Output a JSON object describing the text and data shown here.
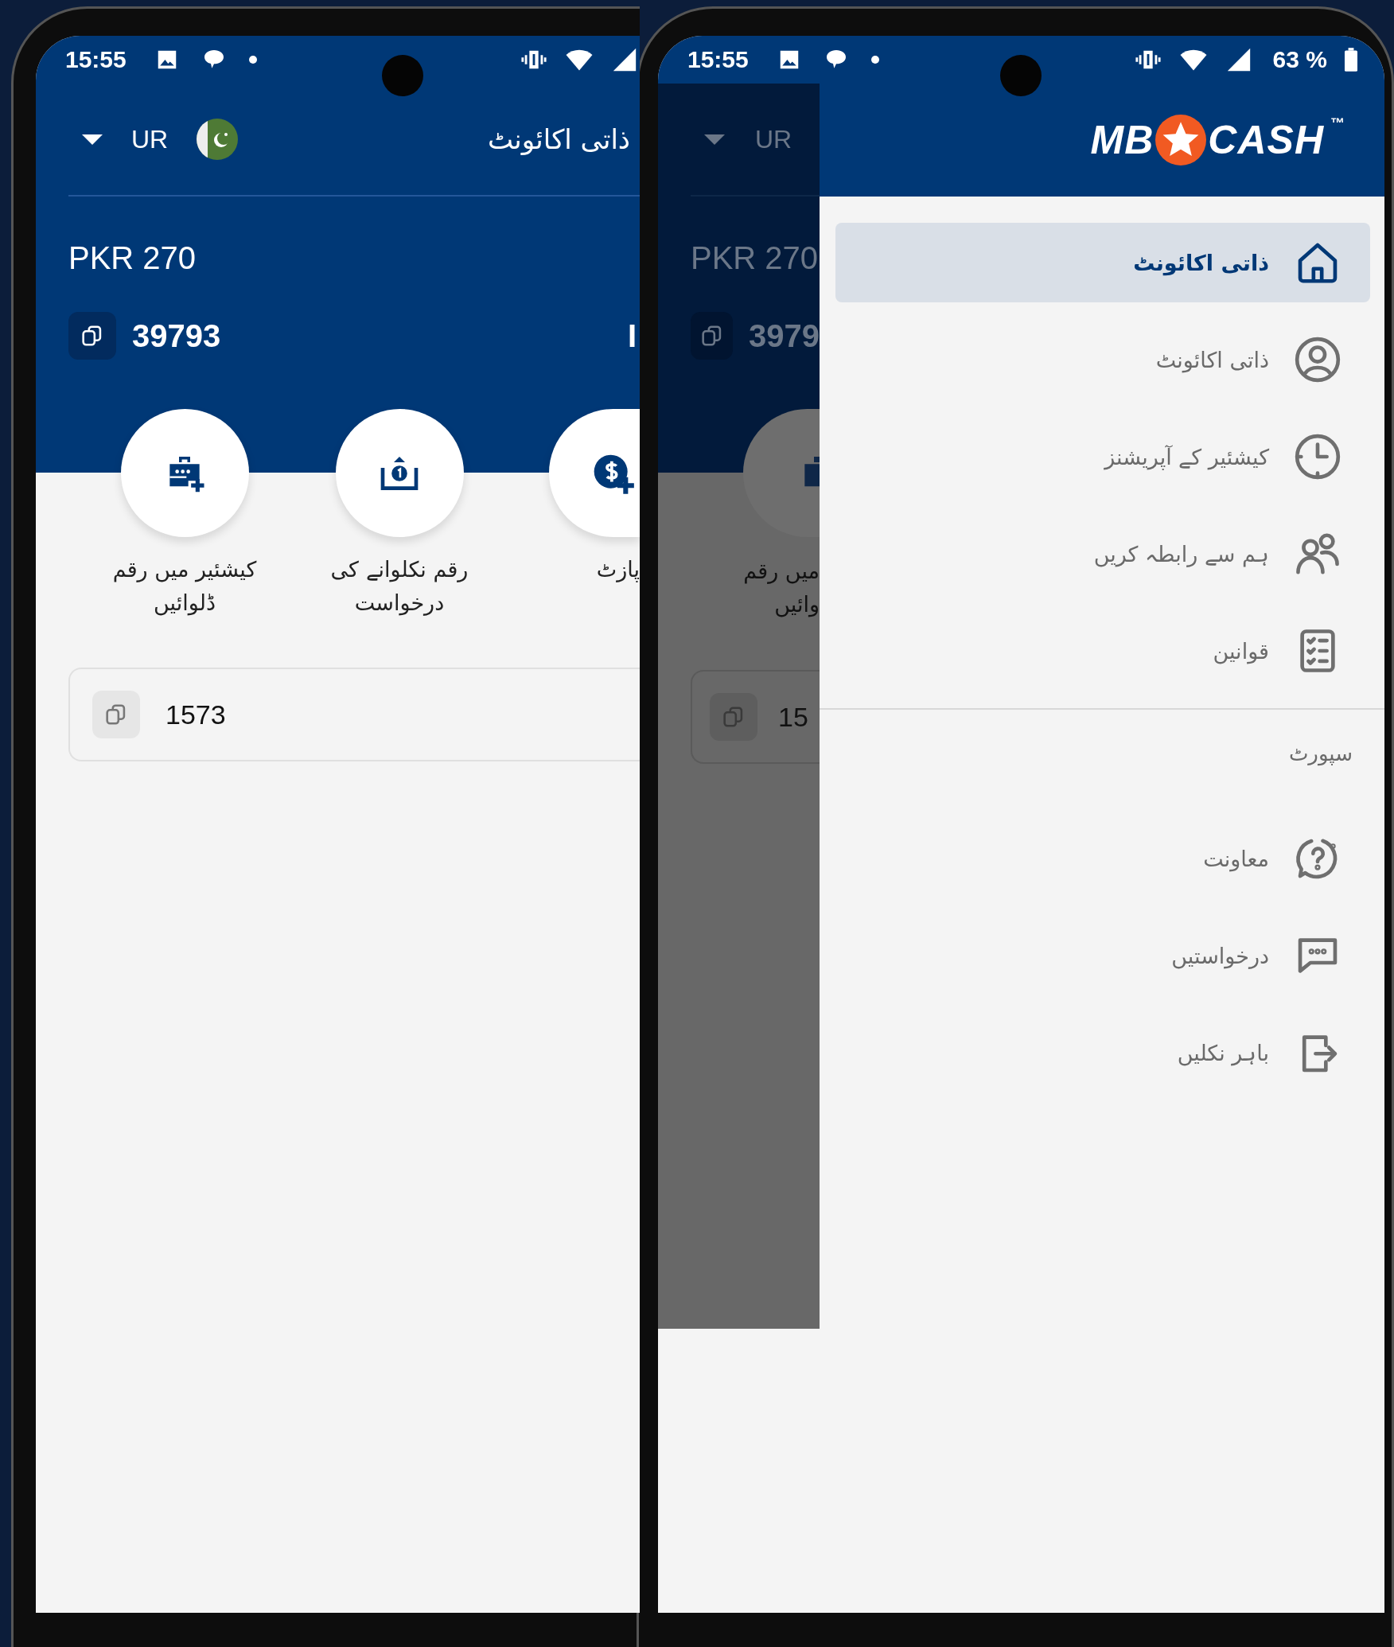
{
  "left_screen": {
    "status_bar": {
      "time": "15:55"
    },
    "header": {
      "language": "UR",
      "title": "ذاتی اکائونٹ"
    },
    "balance": "PKR 270",
    "account": {
      "number": "39793",
      "label": "I"
    },
    "actions": [
      {
        "kind": "deposit",
        "lines": [
          "پازٹ"
        ]
      },
      {
        "kind": "withdraw",
        "lines": [
          "رقم نکلوانے کی",
          "درخواست"
        ]
      },
      {
        "kind": "cashier",
        "lines": [
          "کیشئیر میں رقم",
          "ڈلوائیں"
        ]
      }
    ],
    "code_field": {
      "value": "1573"
    }
  },
  "right_screen": {
    "status_bar": {
      "time": "15:55",
      "battery": "63 %"
    },
    "dimmed_app": {
      "language": "UR",
      "balance": "PKR 270",
      "account_number": "3979",
      "action_lines": [
        "میں رقم",
        "وائیں"
      ],
      "code": "15"
    },
    "drawer": {
      "logo": {
        "left": "MB",
        "right": "CASH",
        "mark": "™"
      },
      "items": [
        {
          "kind": "home",
          "label": "ذاتی اکائونٹ",
          "selected": true
        },
        {
          "kind": "user",
          "label": "ذاتی اکائونٹ",
          "selected": false
        },
        {
          "kind": "clock",
          "label": "کیشئیر کے آپریشنز",
          "selected": false
        },
        {
          "kind": "people",
          "label": "ہم سے رابطہ کریں",
          "selected": false
        },
        {
          "kind": "checklist",
          "label": "قوانین",
          "selected": false
        }
      ],
      "section": "سپورٹ",
      "support_items": [
        {
          "kind": "help",
          "label": "معاونت",
          "selected": false
        },
        {
          "kind": "chat",
          "label": "درخواستیں",
          "selected": false
        },
        {
          "kind": "exit",
          "label": "باہر نکلیں",
          "selected": false
        }
      ]
    }
  }
}
